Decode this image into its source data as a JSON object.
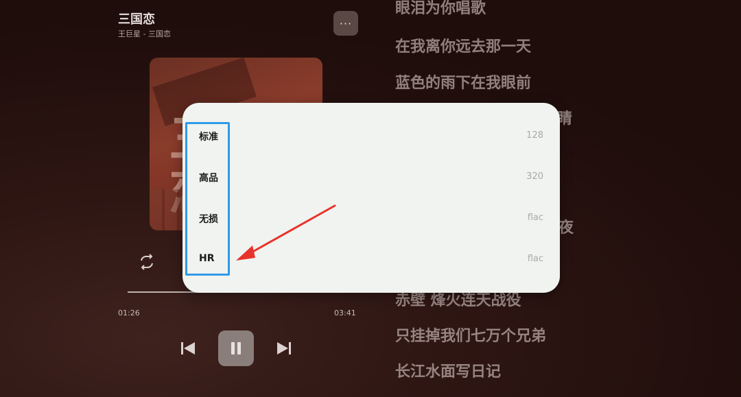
{
  "player": {
    "title": "三国恋",
    "artist": "王巨星 - 三国恋",
    "more_label": "···",
    "cover_glyph": "三\n恋",
    "progress": 0.37,
    "time_current": "01:26",
    "time_total": "03:41"
  },
  "lyrics": [
    "眼泪为你唱歌",
    "在我离你远去那一天",
    "蓝色的雨下在我眼前",
    "睛",
    "夜",
    "赤壁 烽火连天战役",
    "只挂掉我们七万个兄弟",
    "长江水面写日记"
  ],
  "quality_dialog": {
    "options": [
      {
        "label": "标准",
        "value": "128"
      },
      {
        "label": "高品",
        "value": "320"
      },
      {
        "label": "无损",
        "value": "flac"
      },
      {
        "label": "HR",
        "value": "flac"
      }
    ]
  },
  "colors": {
    "highlight": "#2f9ae8",
    "arrow": "#e8332a"
  }
}
